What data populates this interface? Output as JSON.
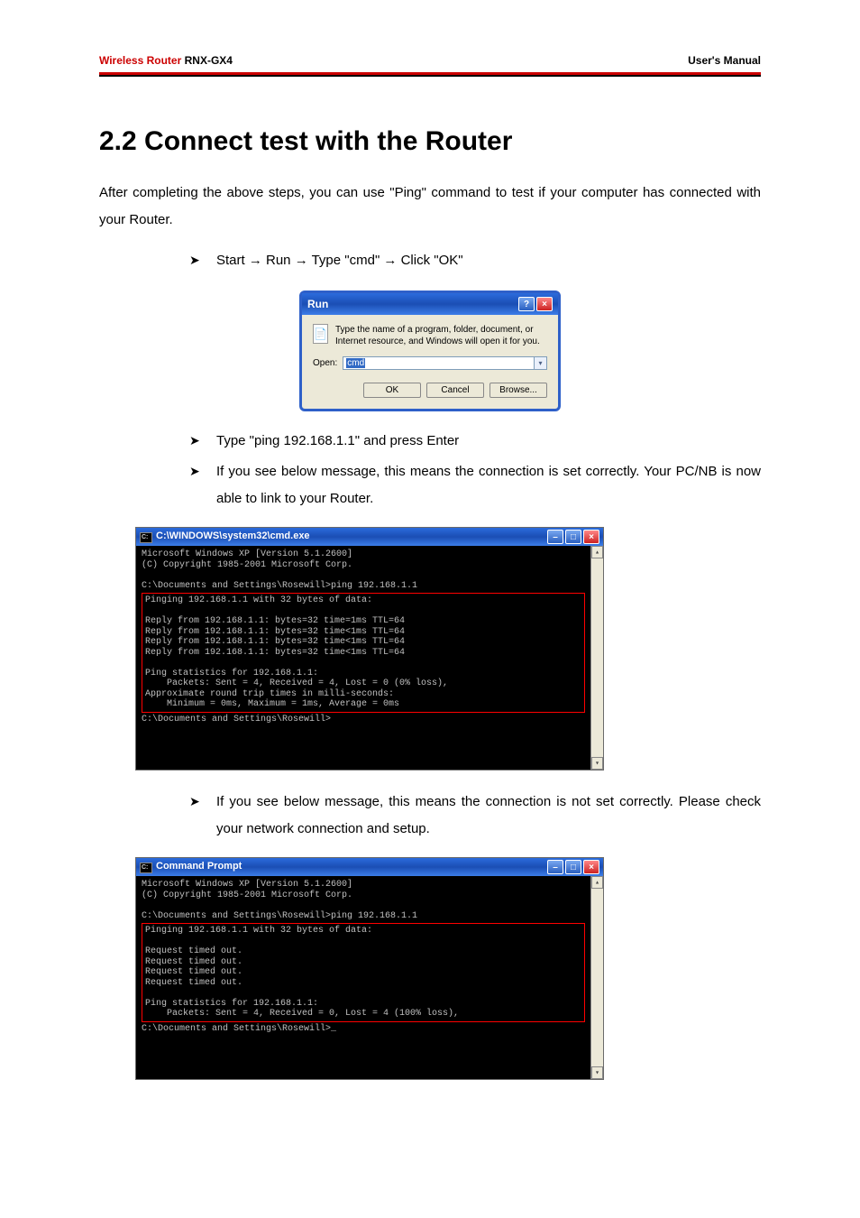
{
  "header": {
    "brand": "Wireless Router",
    "model": "RNX-GX4",
    "right": "User's Manual"
  },
  "section_title": "2.2 Connect test with the Router",
  "intro": "After completing the above steps, you can use \"Ping\" command to test if your computer has connected with your Router.",
  "bullets": {
    "b1": "Start → Run → Type \"cmd\" → Click \"OK\"",
    "b2": "Type \"ping 192.168.1.1\" and press Enter",
    "b3": "If you see below message, this means the connection is set correctly. Your PC/NB is now able to link to your Router.",
    "b4": "If you see below message, this means the connection is not set correctly. Please check your network connection and setup."
  },
  "run_dialog": {
    "title": "Run",
    "desc": "Type the name of a program, folder, document, or Internet resource, and Windows will open it for you.",
    "open_label": "Open:",
    "open_value": "cmd",
    "ok": "OK",
    "cancel": "Cancel",
    "browse": "Browse..."
  },
  "cmd1": {
    "title": "C:\\WINDOWS\\system32\\cmd.exe",
    "line_header1": "Microsoft Windows XP [Version 5.1.2600]",
    "line_header2": "(C) Copyright 1985-2001 Microsoft Corp.",
    "line_cmd": "C:\\Documents and Settings\\Rosewill>ping 192.168.1.1",
    "box": "Pinging 192.168.1.1 with 32 bytes of data:\n\nReply from 192.168.1.1: bytes=32 time=1ms TTL=64\nReply from 192.168.1.1: bytes=32 time<1ms TTL=64\nReply from 192.168.1.1: bytes=32 time<1ms TTL=64\nReply from 192.168.1.1: bytes=32 time<1ms TTL=64\n\nPing statistics for 192.168.1.1:\n    Packets: Sent = 4, Received = 4, Lost = 0 (0% loss),\nApproximate round trip times in milli-seconds:\n    Minimum = 0ms, Maximum = 1ms, Average = 0ms",
    "line_prompt2": "C:\\Documents and Settings\\Rosewill>"
  },
  "cmd2": {
    "title": "Command Prompt",
    "line_header1": "Microsoft Windows XP [Version 5.1.2600]",
    "line_header2": "(C) Copyright 1985-2001 Microsoft Corp.",
    "line_cmd": "C:\\Documents and Settings\\Rosewill>ping 192.168.1.1",
    "box": "Pinging 192.168.1.1 with 32 bytes of data:\n\nRequest timed out.\nRequest timed out.\nRequest timed out.\nRequest timed out.\n\nPing statistics for 192.168.1.1:\n    Packets: Sent = 4, Received = 0, Lost = 4 (100% loss),",
    "line_prompt2": "C:\\Documents and Settings\\Rosewill>_"
  }
}
